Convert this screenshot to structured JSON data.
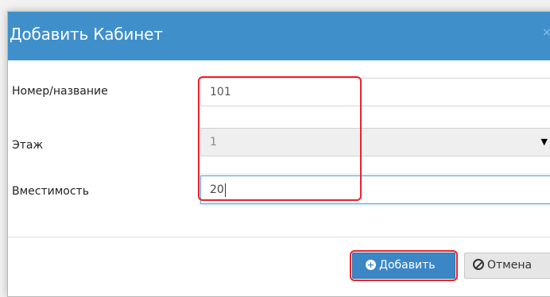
{
  "dialog": {
    "title": "Добавить Кабинет",
    "close_glyph": "×"
  },
  "form": {
    "number": {
      "label": "Номер/название",
      "value": "101"
    },
    "floor": {
      "label": "Этаж",
      "selected": "1",
      "caret_icon": "▼"
    },
    "capacity": {
      "label": "Вместимость",
      "value": "20"
    }
  },
  "buttons": {
    "add_label": "Добавить",
    "cancel_label": "Отмена",
    "add_icon": "plus-circle-icon",
    "cancel_icon": "ban-icon"
  },
  "colors": {
    "header_bg": "#3f8fcb",
    "primary_button": "#3b87c6",
    "highlight_outline": "#e8232a"
  }
}
